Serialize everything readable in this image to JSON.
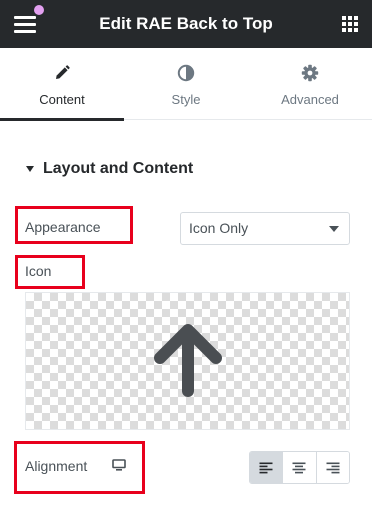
{
  "header": {
    "title": "Edit RAE Back to Top",
    "menu_icon": "hamburger-menu-icon",
    "apps_icon": "grid-icon",
    "notification_dot_color": "#e2a0f0",
    "background": "#26292c"
  },
  "tabs": [
    {
      "label": "Content",
      "icon": "pencil-icon",
      "active": true
    },
    {
      "label": "Style",
      "icon": "half-circle-icon",
      "active": false
    },
    {
      "label": "Advanced",
      "icon": "gear-icon",
      "active": false
    }
  ],
  "section": {
    "title": "Layout and Content",
    "expanded": true
  },
  "controls": {
    "appearance": {
      "label": "Appearance",
      "value": "Icon Only"
    },
    "icon": {
      "label": "Icon",
      "preview_icon": "arrow-up-icon"
    },
    "alignment": {
      "label": "Alignment",
      "responsive_icon": "desktop-icon",
      "options": [
        "align-left-icon",
        "align-center-icon",
        "align-right-icon"
      ],
      "selected": 0
    }
  },
  "colors": {
    "highlight": "#e8001c",
    "text": "#495157",
    "dark": "#26292c",
    "border": "#d5dadf"
  }
}
